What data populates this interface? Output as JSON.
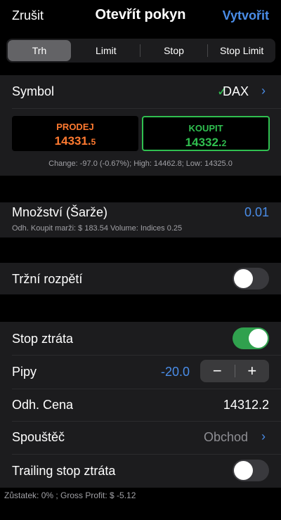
{
  "nav": {
    "cancel": "Zrušit",
    "title": "Otevřít pokyn",
    "create": "Vytvořit"
  },
  "tabs": [
    {
      "label": "Trh",
      "active": true
    },
    {
      "label": "Limit",
      "active": false
    },
    {
      "label": "Stop",
      "active": false
    },
    {
      "label": "Stop Limit",
      "active": false
    }
  ],
  "symbol": {
    "label": "Symbol",
    "value": "DAX"
  },
  "sell": {
    "label": "PRODEJ",
    "price_main": "14331.",
    "price_small": "5"
  },
  "buy": {
    "label": "KOUPIT",
    "price_main": "14332.",
    "price_small": "2"
  },
  "stats": "Change: -97.0 (-0.67%); High: 14462.8; Low: 14325.0",
  "quantity": {
    "label": "Množství (Šarže)",
    "value": "0.01",
    "sub": "Odh. Koupit marži: $ 183.54   Volume: Indices 0.25"
  },
  "market_spread": {
    "label": "Tržní rozpětí",
    "on": false
  },
  "stop_loss": {
    "label": "Stop ztráta",
    "on": true
  },
  "pips": {
    "label": "Pipy",
    "value": "-20.0",
    "minus": "−",
    "plus": "+"
  },
  "est_price": {
    "label": "Odh. Cena",
    "value": "14312.2"
  },
  "trigger": {
    "label": "Spouštěč",
    "value": "Obchod"
  },
  "trailing_stop": {
    "label": "Trailing stop ztráta",
    "on": false
  },
  "footer": "Zůstatek: 0% ; Gross Profit: $ -5.12",
  "colors": {
    "accent": "#4a8de8",
    "sell": "#ff7a30",
    "buy": "#30c050",
    "toggle_on": "#30a14e"
  }
}
